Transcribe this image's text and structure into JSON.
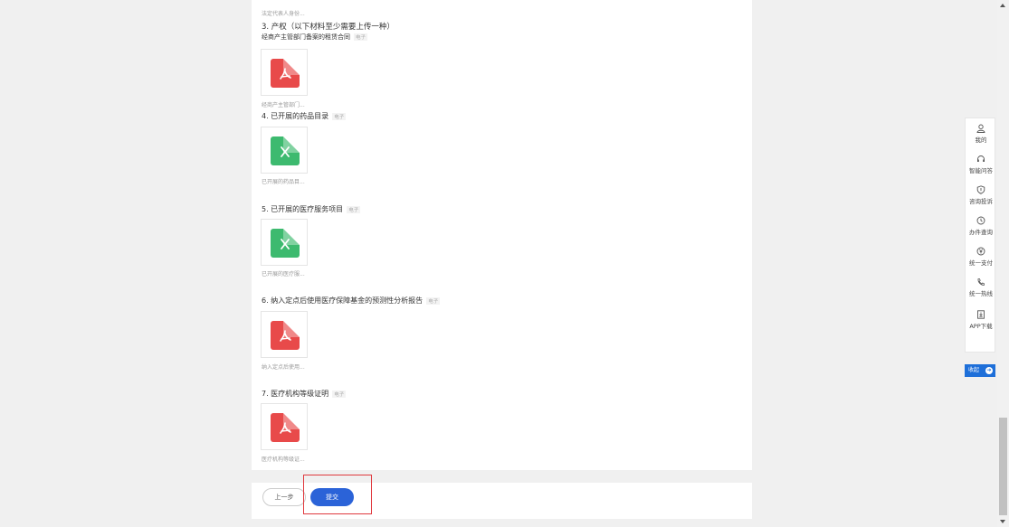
{
  "form": {
    "top_caption": "法定代表人身份...",
    "section3_title": "3. 产权（以下材料至少需要上传一种）",
    "section3_sub": "经商产主管部门备案的租赁合同",
    "section3_caption": "经商产主管部门...",
    "section4_title": "4. 已开展的药品目录",
    "section4_caption": "已开展的药品目...",
    "section5_title": "5. 已开展的医疗服务项目",
    "section5_caption": "已开展的医疗服...",
    "section6_title": "6. 纳入定点后使用医疗保障基金的预测性分析报告",
    "section6_caption": "纳入定点后使用...",
    "section7_title": "7. 医疗机构等级证明",
    "section7_caption": "医疗机构等级证...",
    "tag_electronic": "电子"
  },
  "footer": {
    "prev_label": "上一步",
    "submit_label": "提交"
  },
  "side_panel": {
    "items": [
      {
        "label": "我的",
        "icon": "user-icon"
      },
      {
        "label": "智能问答",
        "icon": "headset-icon"
      },
      {
        "label": "咨询投诉",
        "icon": "shield-icon"
      },
      {
        "label": "办件查询",
        "icon": "history-icon"
      },
      {
        "label": "统一支付",
        "icon": "yen-icon"
      },
      {
        "label": "统一热线",
        "icon": "phone-icon"
      },
      {
        "label": "APP下载",
        "icon": "download-icon"
      }
    ],
    "collapse_label": "收起"
  },
  "colors": {
    "pdf": "#e84a4a",
    "excel": "#3dba6f",
    "primary": "#2b63d8",
    "highlight": "#e0393e"
  }
}
